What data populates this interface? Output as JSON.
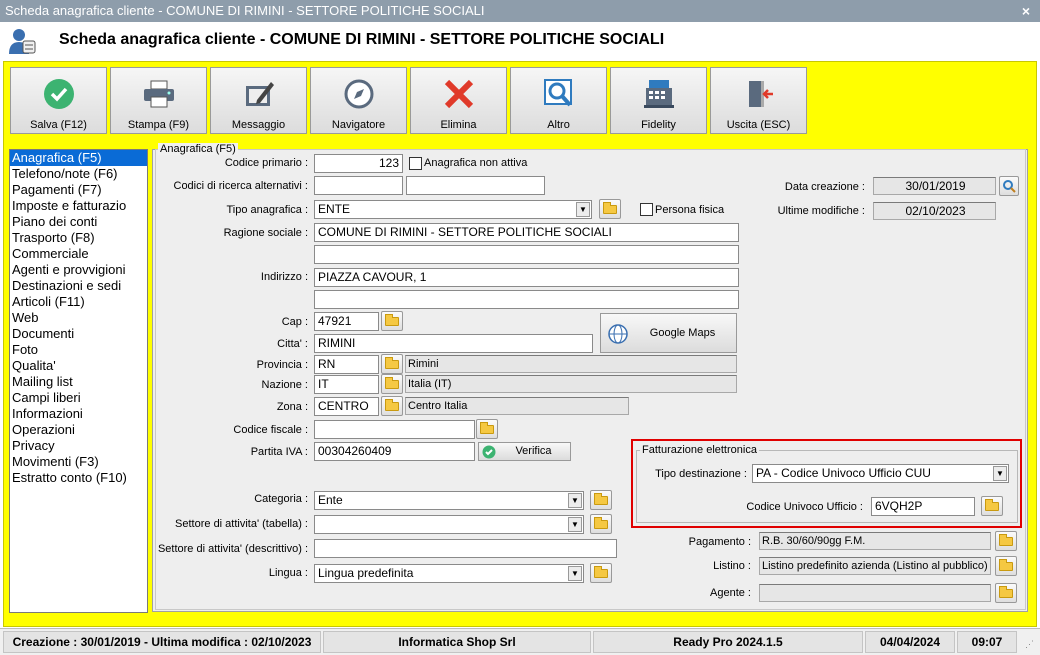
{
  "window": {
    "title": "Scheda anagrafica cliente - COMUNE DI RIMINI - SETTORE POLITICHE SOCIALI",
    "close": "×"
  },
  "header": {
    "title": "Scheda anagrafica cliente - COMUNE DI RIMINI - SETTORE POLITICHE SOCIALI"
  },
  "toolbar": {
    "save": "Salva (F12)",
    "print": "Stampa (F9)",
    "message": "Messaggio",
    "navigator": "Navigatore",
    "delete": "Elimina",
    "other": "Altro",
    "fidelity": "Fidelity",
    "exit": "Uscita (ESC)"
  },
  "sidebar": {
    "items": [
      "Anagrafica (F5)",
      "Telefono/note (F6)",
      "Pagamenti (F7)",
      "Imposte e fatturazio",
      "Piano dei conti",
      "Trasporto (F8)",
      "Commerciale",
      "Agenti e provvigioni",
      "Destinazioni e sedi",
      "Articoli (F11)",
      "Web",
      "Documenti",
      "Foto",
      "Qualita'",
      "Mailing list",
      "Campi liberi",
      "Informazioni",
      "Operazioni",
      "Privacy",
      "Movimenti (F3)",
      "Estratto conto (F10)"
    ],
    "selected": 0
  },
  "form": {
    "group_title": "Anagrafica (F5)",
    "codice_primario_label": "Codice primario :",
    "codice_primario": "123",
    "non_attiva_label": "Anagrafica non attiva",
    "codici_alt_label": "Codici di ricerca alternativi :",
    "tipo_label": "Tipo anagrafica :",
    "tipo": "ENTE",
    "persona_fisica_label": "Persona fisica",
    "ragione_label": "Ragione sociale :",
    "ragione": "COMUNE DI RIMINI - SETTORE POLITICHE SOCIALI",
    "indirizzo_label": "Indirizzo :",
    "indirizzo": "PIAZZA CAVOUR, 1",
    "cap_label": "Cap :",
    "cap": "47921",
    "google_maps": "Google Maps",
    "citta_label": "Citta' :",
    "citta": "RIMINI",
    "provincia_label": "Provincia :",
    "provincia": "RN",
    "provincia_desc": "Rimini",
    "nazione_label": "Nazione :",
    "nazione": "IT",
    "nazione_desc": "Italia (IT)",
    "zona_label": "Zona :",
    "zona": "CENTRO",
    "zona_desc": "Centro Italia",
    "cf_label": "Codice fiscale :",
    "piva_label": "Partita IVA :",
    "piva": "00304260409",
    "verifica": "Verifica",
    "categoria_label": "Categoria :",
    "categoria": "Ente",
    "settore_tab_label": "Settore di attivita' (tabella) :",
    "settore_desc_label": "Settore di attivita' (descrittivo) :",
    "lingua_label": "Lingua :",
    "lingua": "Lingua predefinita",
    "data_creazione_label": "Data creazione :",
    "data_creazione": "30/01/2019",
    "ultime_mod_label": "Ultime modifiche :",
    "ultime_mod": "02/10/2023",
    "fe_title": "Fatturazione elettronica",
    "tipo_dest_label": "Tipo destinazione :",
    "tipo_dest": "PA - Codice Univoco Ufficio CUU",
    "cuu_label": "Codice Univoco Ufficio :",
    "cuu": "6VQH2P",
    "pagamento_label": "Pagamento :",
    "pagamento": "R.B. 30/60/90gg F.M.",
    "listino_label": "Listino :",
    "listino": "Listino predefinito azienda (Listino al pubblico)",
    "agente_label": "Agente :"
  },
  "status": {
    "dates": "Creazione : 30/01/2019 - Ultima modifica : 02/10/2023",
    "company": "Informatica Shop Srl",
    "product": "Ready Pro 2024.1.5",
    "date": "04/04/2024",
    "time": "09:07"
  },
  "colors": {
    "background": "#ffff00",
    "selection": "#0a6bd6",
    "highlight_border": "#e00000"
  }
}
